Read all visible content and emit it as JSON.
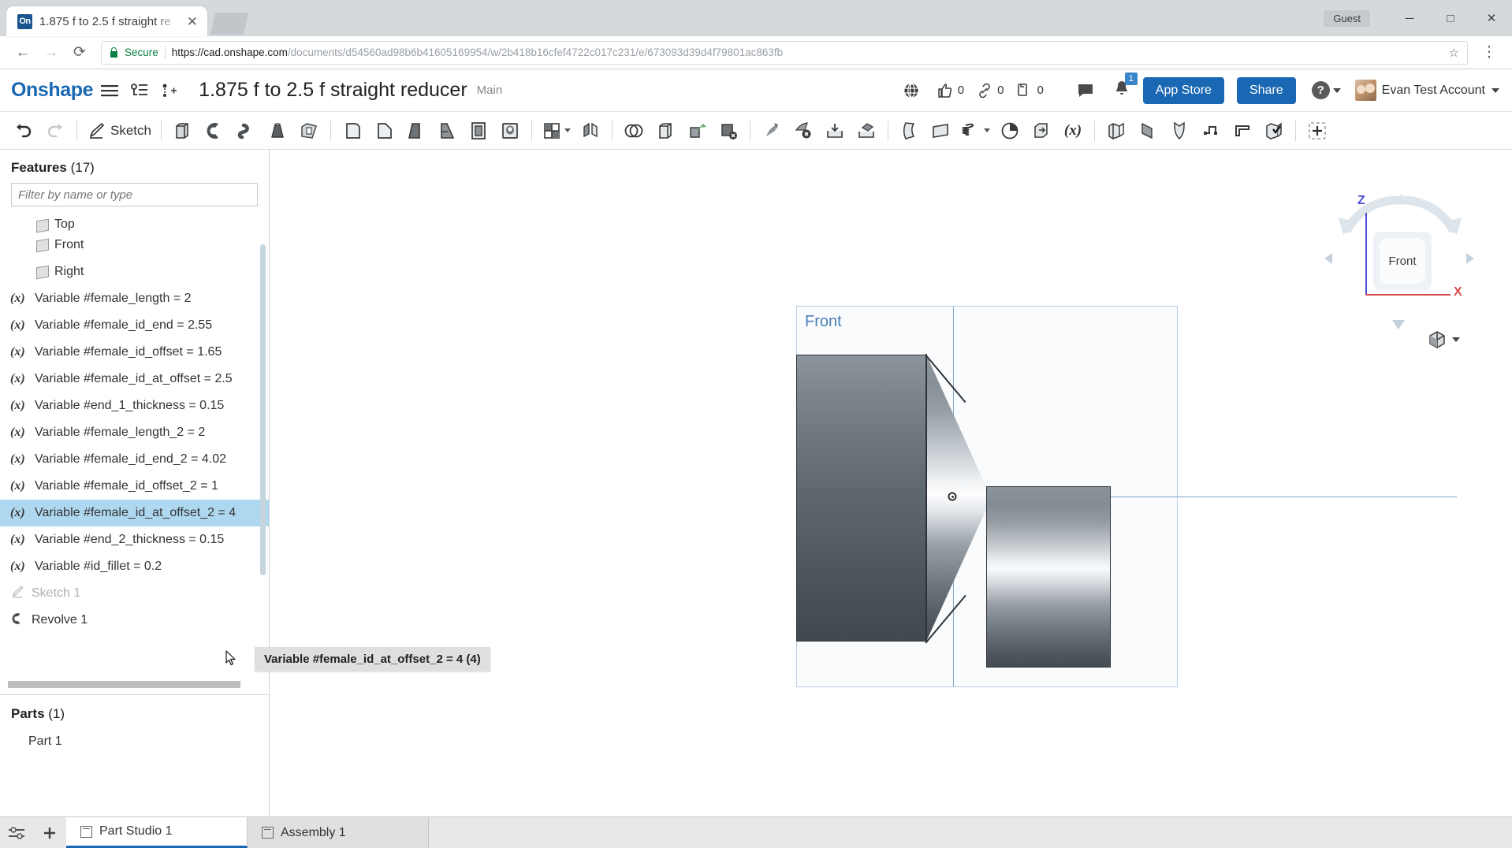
{
  "browser": {
    "tab": {
      "favicon_label": "On",
      "title": "1.875 f to 2.5 f straight re",
      "close_icon": "close-icon"
    },
    "guest_label": "Guest",
    "window_controls": {
      "minimize": "─",
      "maximize": "□",
      "close": "✕"
    },
    "nav": {
      "back": "←",
      "forward": "→",
      "reload": "⟳"
    },
    "omnibox": {
      "secure_label": "Secure",
      "url_domain": "https://cad.onshape.com",
      "url_path": "/documents/d54560ad98b6b41605169954/w/2b418b16cfef4722c017c231/e/673093d39d4f79801ac863fb",
      "star_icon": "star-icon",
      "menu_icon": "kebab-menu-icon"
    }
  },
  "header": {
    "logo": "Onshape",
    "menu_icon": "hamburger-menu-icon",
    "feature_tree_icon": "document-tree-icon",
    "insert_icon": "insert-version-icon",
    "doc_title": "1.875 f to 2.5 f straight reducer",
    "branch": "Main",
    "public_icon": "globe-icon",
    "like": {
      "icon": "thumbs-up-icon",
      "count": "0"
    },
    "links": {
      "icon": "link-icon",
      "count": "0"
    },
    "copies": {
      "icon": "copy-icon",
      "count": "0"
    },
    "comments_icon": "comment-bubble-icon",
    "notifications": {
      "icon": "bell-icon",
      "badge": "1"
    },
    "app_store_label": "App Store",
    "share_label": "Share",
    "help_label": "?",
    "account_name": "Evan Test Account"
  },
  "toolbar": {
    "undo": "undo-icon",
    "redo": "redo-icon",
    "sketch_label": "Sketch",
    "items": [
      {
        "name": "extrude-icon"
      },
      {
        "name": "revolve-icon"
      },
      {
        "name": "sweep-icon"
      },
      {
        "name": "loft-icon"
      },
      {
        "name": "thicken-icon"
      },
      {
        "name": "fillet-icon"
      },
      {
        "name": "chamfer-icon"
      },
      {
        "name": "draft-icon"
      },
      {
        "name": "rib-icon"
      },
      {
        "name": "shell-icon"
      },
      {
        "name": "hole-icon"
      },
      {
        "name": "pattern-icon",
        "has_caret": true
      },
      {
        "name": "mirror-icon"
      },
      {
        "name": "boolean-icon"
      },
      {
        "name": "split-icon"
      },
      {
        "name": "transform-icon"
      },
      {
        "name": "delete-face-icon"
      },
      {
        "name": "move-face-icon"
      },
      {
        "name": "delete-part-icon"
      },
      {
        "name": "import-icon"
      },
      {
        "name": "export-icon"
      },
      {
        "name": "surface-icon"
      },
      {
        "name": "plane-icon"
      },
      {
        "name": "helix-icon",
        "has_caret": true
      },
      {
        "name": "curve-icon"
      },
      {
        "name": "derive-icon"
      },
      {
        "name": "variable-icon"
      },
      {
        "name": "sheetmetal-model-icon"
      },
      {
        "name": "flange-icon"
      },
      {
        "name": "sm-bend-icon"
      },
      {
        "name": "sm-joint-icon"
      },
      {
        "name": "sm-tab-icon"
      },
      {
        "name": "sm-finish-icon"
      },
      {
        "name": "add-custom-feature-icon"
      }
    ]
  },
  "left_panel": {
    "features_title": "Features",
    "features_count": "(17)",
    "filter_placeholder": "Filter by name or type",
    "features": [
      {
        "label": "Top",
        "icon": "plane-icon",
        "type": "plane",
        "indent": true,
        "clipped": true
      },
      {
        "label": "Front",
        "icon": "plane-icon",
        "type": "plane",
        "indent": true
      },
      {
        "label": "Right",
        "icon": "plane-icon",
        "type": "plane",
        "indent": true
      },
      {
        "label": "Variable #female_length = 2",
        "icon": "variable-icon",
        "type": "variable"
      },
      {
        "label": "Variable #female_id_end = 2.55",
        "icon": "variable-icon",
        "type": "variable"
      },
      {
        "label": "Variable #female_id_offset = 1.65",
        "icon": "variable-icon",
        "type": "variable"
      },
      {
        "label": "Variable #female_id_at_offset = 2.5",
        "icon": "variable-icon",
        "type": "variable"
      },
      {
        "label": "Variable #end_1_thickness = 0.15",
        "icon": "variable-icon",
        "type": "variable"
      },
      {
        "label": "Variable #female_length_2 = 2",
        "icon": "variable-icon",
        "type": "variable"
      },
      {
        "label": "Variable #female_id_end_2 = 4.02",
        "icon": "variable-icon",
        "type": "variable"
      },
      {
        "label": "Variable #female_id_offset_2 = 1",
        "icon": "variable-icon",
        "type": "variable"
      },
      {
        "label": "Variable #female_id_at_offset_2 = 4",
        "icon": "variable-icon",
        "type": "variable",
        "selected": true
      },
      {
        "label": "Variable #end_2_thickness = 0.15",
        "icon": "variable-icon",
        "type": "variable"
      },
      {
        "label": "Variable #id_fillet = 0.2",
        "icon": "variable-icon",
        "type": "variable"
      },
      {
        "label": "Sketch 1",
        "icon": "sketch-icon",
        "type": "sketch",
        "dim": true
      },
      {
        "label": "Revolve 1",
        "icon": "revolve-icon",
        "type": "revolve"
      }
    ],
    "tooltip": "Variable #female_id_at_offset_2 = 4 (4)",
    "parts_title": "Parts",
    "parts_count": "(1)",
    "parts": [
      {
        "label": "Part 1"
      }
    ]
  },
  "viewport": {
    "plane_label": "Front",
    "view_cube_face": "Front",
    "axis_z_label": "Z",
    "axis_x_label": "X",
    "view_style_icon": "shaded-view-icon",
    "nav_arrows": [
      "rotate-up-left-icon",
      "rotate-up-right-icon",
      "pan-left-icon",
      "pan-right-icon",
      "pan-down-icon"
    ]
  },
  "footer": {
    "tools_icon": "tabs-settings-icon",
    "add_icon": "add-tab-icon",
    "tabs": [
      {
        "label": "Part Studio 1",
        "icon": "part-studio-icon",
        "active": true
      },
      {
        "label": "Assembly 1",
        "icon": "assembly-icon",
        "active": false
      }
    ]
  },
  "colors": {
    "onshape_blue": "#1a68b3",
    "selection_blue": "#aed8ef",
    "plane_outline": "#b8cbe0",
    "axis_blue": "#7fa8cf",
    "axis_z": "#4b4bd8",
    "axis_x": "#d84b4b",
    "secure_green": "#0b8043"
  }
}
